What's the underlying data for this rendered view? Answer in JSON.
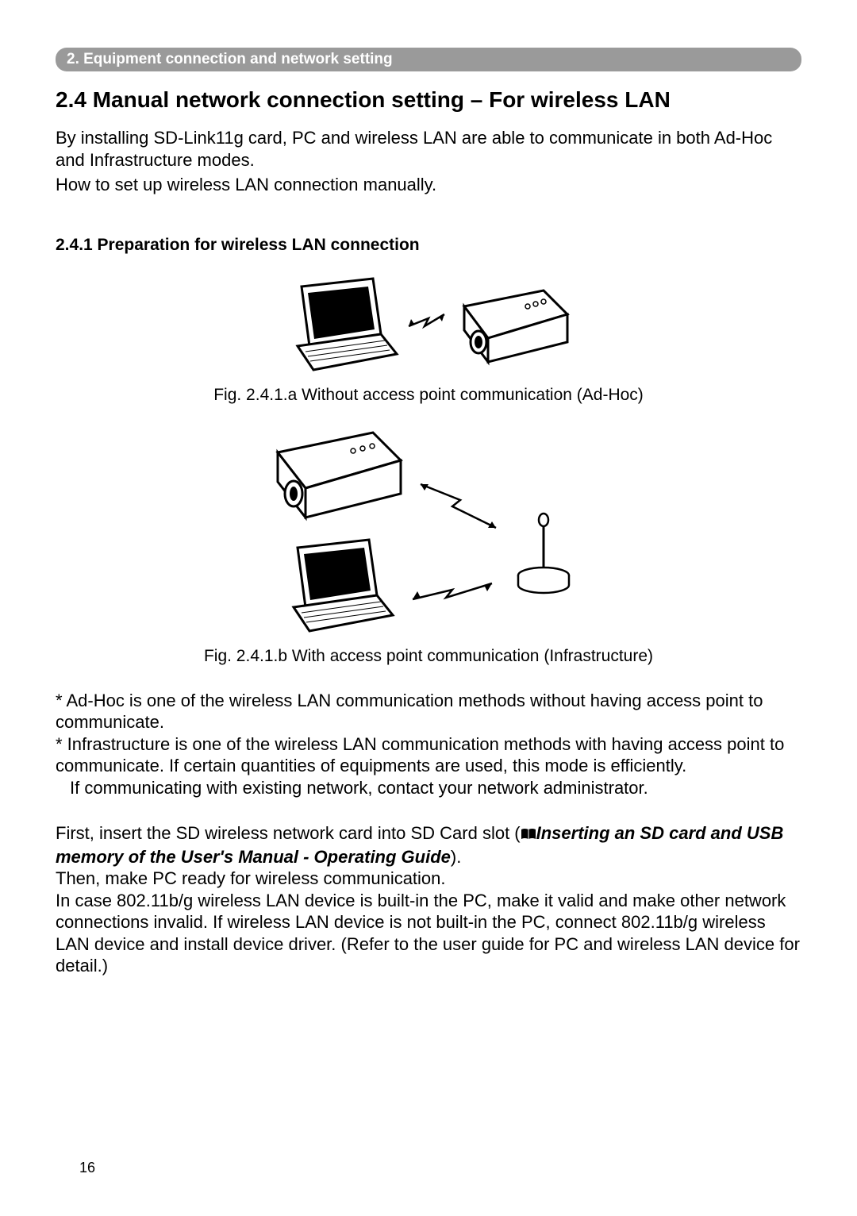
{
  "header": {
    "breadcrumb": "2. Equipment connection and network setting"
  },
  "section": {
    "title": "2.4 Manual network connection setting – For wireless LAN",
    "intro1": "By installing SD-Link11g card, PC and wireless LAN are able to communicate in both Ad-Hoc and Infrastructure modes.",
    "intro2": "How to set up wireless LAN connection manually."
  },
  "subsection": {
    "title": "2.4.1 Preparation for wireless LAN connection"
  },
  "figureA": {
    "caption": "Fig. 2.4.1.a Without access point communication (Ad-Hoc)"
  },
  "figureB": {
    "caption": "Fig. 2.4.1.b With access point communication (Infrastructure)"
  },
  "bullets": {
    "b1": "* Ad-Hoc is one of the wireless LAN communication methods without having access point to communicate.",
    "b2": "* Infrastructure is one of the wireless LAN communication methods with having access point to communicate. If certain quantities of equipments are used, this mode is efficiently.",
    "b3": "If communicating with existing network, contact your network administrator."
  },
  "paragraph": {
    "p1a": "First, insert the SD wireless network card into SD Card slot (",
    "p1ref": "Inserting an SD card and USB memory of the User's Manual - Operating Guide",
    "p1b": ").",
    "p2": "Then, make PC ready for wireless communication.",
    "p3": "In case 802.11b/g wireless LAN device is built-in the PC, make it valid and make other network connections invalid. If wireless LAN device is not built-in the PC, connect 802.11b/g wireless LAN device and install device driver. (Refer to the user guide for PC and wireless LAN device for detail.)"
  },
  "pageNumber": "16"
}
